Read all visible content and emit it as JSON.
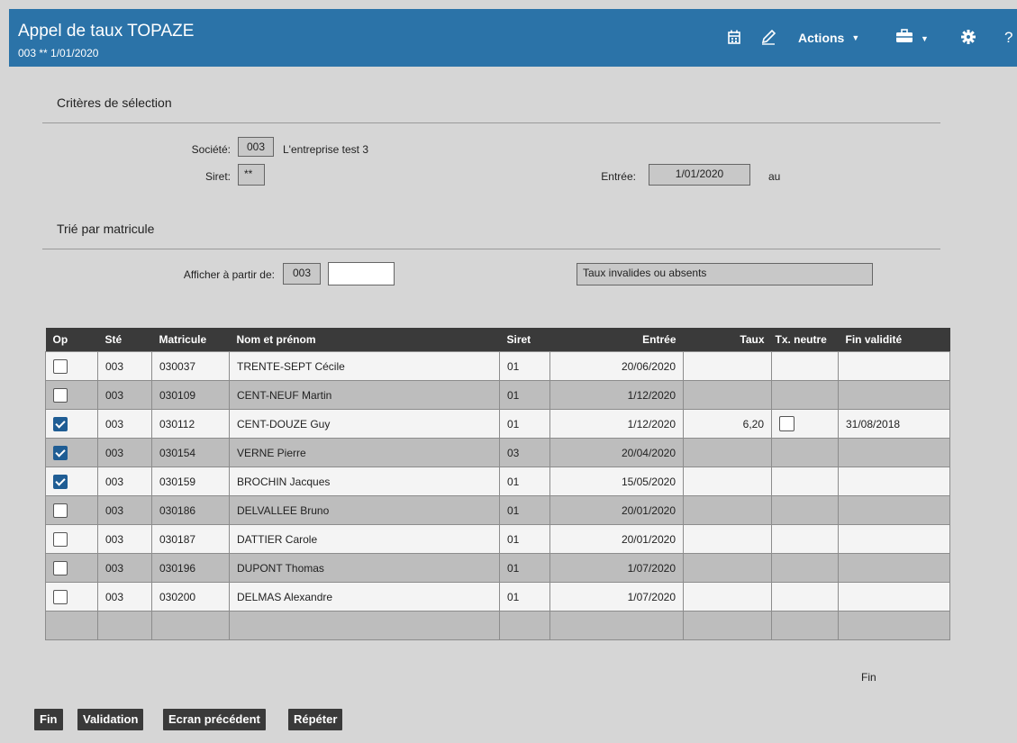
{
  "header": {
    "title": "Appel de taux TOPAZE",
    "subtitle": "003 ** 1/01/2020",
    "actions_label": "Actions",
    "icons": [
      "calendar-icon",
      "pencil-icon",
      "briefcase-icon",
      "gear-icon",
      "help-icon"
    ],
    "help_glyph": "?"
  },
  "criteria": {
    "section_title": "Critères de sélection",
    "societe_label": "Société:",
    "societe_value": "003",
    "societe_name": "L'entreprise test  3",
    "siret_label": "Siret:",
    "siret_value": "**",
    "entree_label": "Entrée:",
    "entree_value": "1/01/2020",
    "au_label": "au"
  },
  "sort": {
    "section_title": "Trié par matricule",
    "afficher_label": "Afficher à partir de:",
    "afficher_value": "003",
    "afficher_input": "",
    "status_message": "Taux invalides ou absents"
  },
  "table": {
    "columns": [
      "Op",
      "Sté",
      "Matricule",
      "Nom et prénom",
      "Siret",
      "Entrée",
      "Taux",
      "Tx. neutre",
      "Fin validité"
    ],
    "rows": [
      {
        "checked": false,
        "ste": "003",
        "matricule": "030037",
        "nom": "TRENTE-SEPT Cécile",
        "siret": "01",
        "entree": "20/06/2020",
        "taux": "",
        "neutre": false,
        "fin": ""
      },
      {
        "checked": false,
        "ste": "003",
        "matricule": "030109",
        "nom": "CENT-NEUF Martin",
        "siret": "01",
        "entree": "1/12/2020",
        "taux": "",
        "neutre": false,
        "fin": ""
      },
      {
        "checked": true,
        "ste": "003",
        "matricule": "030112",
        "nom": "CENT-DOUZE Guy",
        "siret": "01",
        "entree": "1/12/2020",
        "taux": "6,20",
        "neutre": true,
        "fin": "31/08/2018"
      },
      {
        "checked": true,
        "ste": "003",
        "matricule": "030154",
        "nom": "VERNE Pierre",
        "siret": "03",
        "entree": "20/04/2020",
        "taux": "",
        "neutre": false,
        "fin": ""
      },
      {
        "checked": true,
        "ste": "003",
        "matricule": "030159",
        "nom": "BROCHIN Jacques",
        "siret": "01",
        "entree": "15/05/2020",
        "taux": "",
        "neutre": false,
        "fin": ""
      },
      {
        "checked": false,
        "ste": "003",
        "matricule": "030186",
        "nom": "DELVALLEE Bruno",
        "siret": "01",
        "entree": "20/01/2020",
        "taux": "",
        "neutre": false,
        "fin": ""
      },
      {
        "checked": false,
        "ste": "003",
        "matricule": "030187",
        "nom": "DATTIER Carole",
        "siret": "01",
        "entree": "20/01/2020",
        "taux": "",
        "neutre": false,
        "fin": ""
      },
      {
        "checked": false,
        "ste": "003",
        "matricule": "030196",
        "nom": "DUPONT Thomas",
        "siret": "01",
        "entree": "1/07/2020",
        "taux": "",
        "neutre": false,
        "fin": ""
      },
      {
        "checked": false,
        "ste": "003",
        "matricule": "030200",
        "nom": "DELMAS Alexandre",
        "siret": "01",
        "entree": "1/07/2020",
        "taux": "",
        "neutre": false,
        "fin": ""
      }
    ],
    "footer_text": "Fin"
  },
  "buttons": {
    "fin": "Fin",
    "validation": "Validation",
    "ecran_precedent": "Ecran précédent",
    "repeter": "Répéter"
  }
}
